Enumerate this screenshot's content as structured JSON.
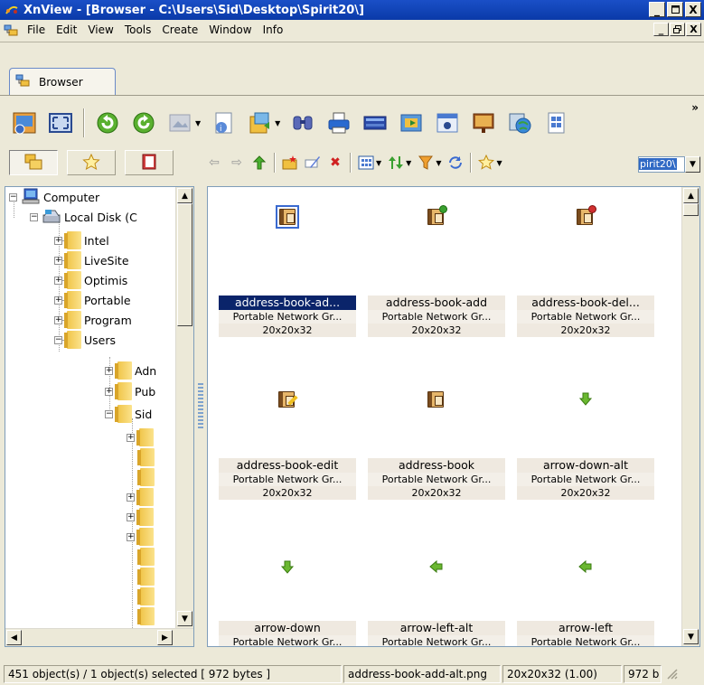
{
  "window": {
    "title": "XnView - [Browser - C:\\Users\\Sid\\Desktop\\Spirit20\\]",
    "minimize": "_",
    "maximize": "□",
    "close": "X"
  },
  "menu": {
    "items": [
      "File",
      "Edit",
      "View",
      "Tools",
      "Create",
      "Window",
      "Info"
    ]
  },
  "tab": {
    "label": "Browser"
  },
  "toolbar": {
    "path_value": "pirit20\\",
    "overflow": "»"
  },
  "tree": {
    "items": [
      {
        "label": "Computer"
      },
      {
        "label": "Local Disk (C"
      },
      {
        "label": "Intel"
      },
      {
        "label": "LiveSite"
      },
      {
        "label": "Optimis"
      },
      {
        "label": "Portable"
      },
      {
        "label": "Program"
      },
      {
        "label": "Users"
      },
      {
        "label": "Adn"
      },
      {
        "label": "Pub"
      },
      {
        "label": "Sid"
      }
    ]
  },
  "files": [
    {
      "name": "address-book-ad...",
      "type": "Portable Network Gr...",
      "dims": "20x20x32",
      "selected": true,
      "icon": "address-book-add-alt"
    },
    {
      "name": "address-book-add",
      "type": "Portable Network Gr...",
      "dims": "20x20x32",
      "selected": false,
      "icon": "address-book-add"
    },
    {
      "name": "address-book-del...",
      "type": "Portable Network Gr...",
      "dims": "20x20x32",
      "selected": false,
      "icon": "address-book-delete"
    },
    {
      "name": "address-book-edit",
      "type": "Portable Network Gr...",
      "dims": "20x20x32",
      "selected": false,
      "icon": "address-book-edit"
    },
    {
      "name": "address-book",
      "type": "Portable Network Gr...",
      "dims": "20x20x32",
      "selected": false,
      "icon": "address-book"
    },
    {
      "name": "arrow-down-alt",
      "type": "Portable Network Gr...",
      "dims": "20x20x32",
      "selected": false,
      "icon": "arrow-down-alt"
    },
    {
      "name": "arrow-down",
      "type": "Portable Network Gr...",
      "dims": "",
      "selected": false,
      "icon": "arrow-down"
    },
    {
      "name": "arrow-left-alt",
      "type": "Portable Network Gr...",
      "dims": "",
      "selected": false,
      "icon": "arrow-left-alt"
    },
    {
      "name": "arrow-left",
      "type": "Portable Network Gr...",
      "dims": "",
      "selected": false,
      "icon": "arrow-left"
    }
  ],
  "status": {
    "count": "451 object(s) / 1 object(s) selected  [ 972 bytes ]",
    "filename": "address-book-add-alt.png",
    "info": "20x20x32 (1.00)",
    "size": "972 b"
  }
}
